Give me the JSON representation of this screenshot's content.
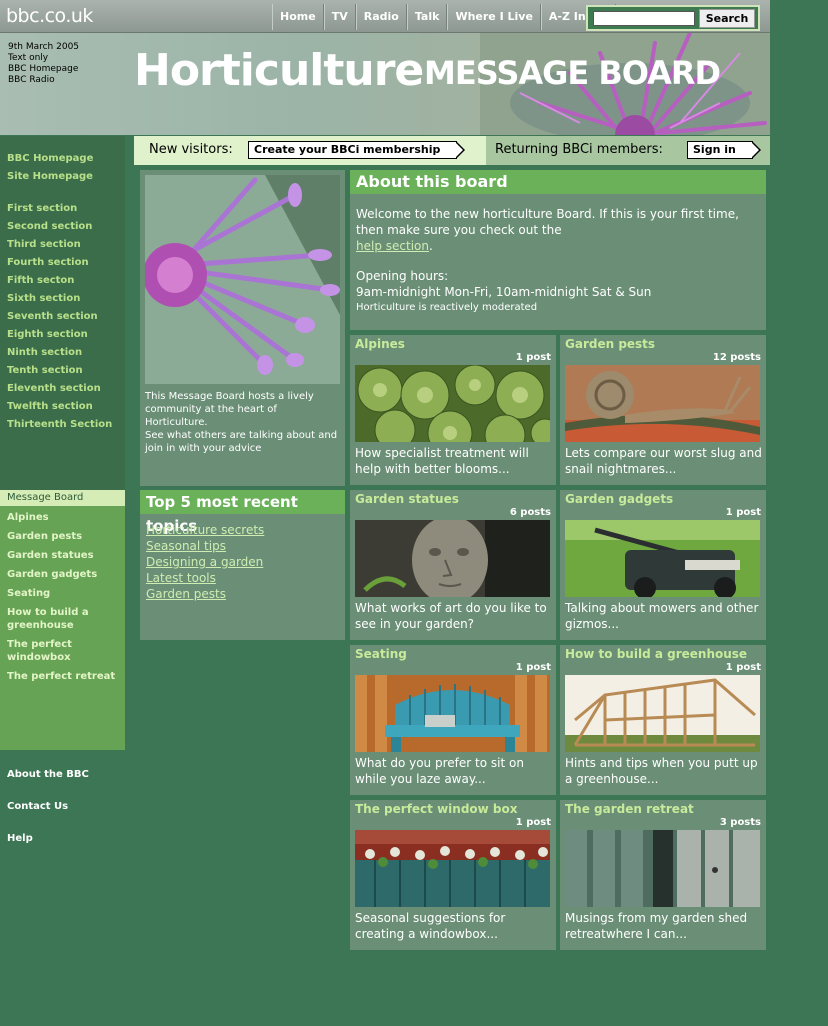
{
  "header": {
    "logo": "bbc.co.uk",
    "nav": [
      "Home",
      "TV",
      "Radio",
      "Talk",
      "Where I Live",
      "A-Z Index"
    ],
    "search_button": "Search",
    "search_value": ""
  },
  "banner": {
    "date": "9th March 2005",
    "text_only": "Text only",
    "bbc_homepage": "BBC Homepage",
    "bbc_radio": "BBC Radio",
    "title": "Horticulture",
    "subtitle": "MESSAGE BOARD"
  },
  "membership": {
    "new_label": "New visitors:",
    "new_button": "Create your BBCi membership",
    "returning_label": "Returning BBCi members:",
    "returning_button": "Sign in"
  },
  "sidebar": {
    "top_links": [
      "BBC Homepage",
      "Site Homepage"
    ],
    "sections": [
      "First section",
      "Second section",
      "Third section",
      "Fourth section",
      "Fifth secton",
      "Sixth section",
      "Seventh section",
      "Eighth section",
      "Ninth section",
      "Tenth section",
      "Eleventh section",
      "Twelfth section",
      "Thirteenth Section"
    ],
    "active": "Message Board",
    "board_links": [
      "Alpines",
      "Garden pests",
      "Garden statues",
      "Garden gadgets",
      "Seating",
      "How to build a greenhouse",
      "The perfect windowbox",
      "The perfect retreat"
    ],
    "bottom_links": [
      "About the BBC",
      "Contact Us",
      "Help"
    ]
  },
  "intro": {
    "text": "This Message Board hosts a lively community at the heart of Horticulture.",
    "text2": "See what others are talking about and join in with your advice"
  },
  "about": {
    "heading": "About this board",
    "welcome": "Welcome to the new horticulture Board. If this is your first time, then make sure you check out the",
    "help_link": "help section",
    "after_link": ".",
    "hours_label": "Opening hours:",
    "hours": "9am-midnight Mon-Fri,  10am-midnight Sat & Sun",
    "moderated": "Horticulture is reactively moderated"
  },
  "top5": {
    "heading": "Top 5 most recent topics",
    "items": [
      "Horticulture secrets",
      "Seasonal tips",
      "Designing a garden",
      "Latest tools",
      "Garden pests"
    ]
  },
  "cards": [
    {
      "title": "Alpines",
      "posts": "1 post",
      "desc": "How specialist treatment will help with better blooms..."
    },
    {
      "title": "Garden pests",
      "posts": "12 posts",
      "desc": "Lets compare our worst slug and snail nightmares..."
    },
    {
      "title": "Garden statues",
      "posts": "6 posts",
      "desc": "What works of art do you like to see in your garden?"
    },
    {
      "title": "Garden gadgets",
      "posts": "1 post",
      "desc": "Talking about mowers and other gizmos..."
    },
    {
      "title": "Seating",
      "posts": "1 post",
      "desc": "What do you prefer to sit on while you laze away..."
    },
    {
      "title": "How to build a greenhouse",
      "posts": "1 post",
      "desc": "Hints and tips when you putt up a greenhouse..."
    },
    {
      "title": "The perfect window box",
      "posts": "1 post",
      "desc": "Seasonal suggestions for creating a windowbox..."
    },
    {
      "title": "The garden retreat",
      "posts": "3 posts",
      "desc": "Musings from my garden shed retreatwhere I can..."
    }
  ]
}
